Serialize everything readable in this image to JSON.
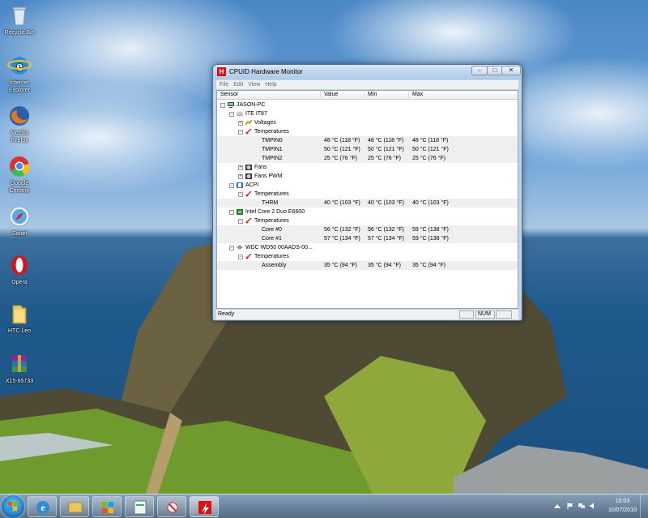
{
  "desktop": {
    "icons": [
      {
        "name": "recycle-bin-icon",
        "label": "Recycle Bin"
      },
      {
        "name": "internet-explorer-icon",
        "label": "Internet Explorer"
      },
      {
        "name": "mozilla-firefox-icon",
        "label": "Mozilla Firefox"
      },
      {
        "name": "google-chrome-icon",
        "label": "Google Chrome"
      },
      {
        "name": "safari-icon",
        "label": "Safari"
      },
      {
        "name": "opera-icon",
        "label": "Opera"
      },
      {
        "name": "folder-icon",
        "label": "HTC Leo"
      },
      {
        "name": "winrar-archive-icon",
        "label": "X15-65733"
      }
    ]
  },
  "window": {
    "title": "CPUID Hardware Monitor",
    "controls": {
      "minimize": "–",
      "maximize": "□",
      "close": "✕"
    },
    "menu": [
      "File",
      "Edit",
      "View",
      "Help"
    ],
    "columns": [
      "Sensor",
      "Value",
      "Min",
      "Max"
    ],
    "rows": [
      {
        "label": "JASON-PC",
        "value": "",
        "min": "",
        "max": ""
      },
      {
        "label": "ITE IT87",
        "value": "",
        "min": "",
        "max": ""
      },
      {
        "label": "Voltages",
        "value": "",
        "min": "",
        "max": ""
      },
      {
        "label": "Temperatures",
        "value": "",
        "min": "",
        "max": ""
      },
      {
        "label": "TMPIN0",
        "value": "48 °C  (118 °F)",
        "min": "48 °C  (118 °F)",
        "max": "48 °C  (118 °F)"
      },
      {
        "label": "TMPIN1",
        "value": "50 °C  (121 °F)",
        "min": "50 °C  (121 °F)",
        "max": "50 °C  (121 °F)"
      },
      {
        "label": "TMPIN2",
        "value": "25 °C  (76 °F)",
        "min": "25 °C  (76 °F)",
        "max": "25 °C  (76 °F)"
      },
      {
        "label": "Fans",
        "value": "",
        "min": "",
        "max": ""
      },
      {
        "label": "Fans PWM",
        "value": "",
        "min": "",
        "max": ""
      },
      {
        "label": "ACPI",
        "value": "",
        "min": "",
        "max": ""
      },
      {
        "label": "Temperatures",
        "value": "",
        "min": "",
        "max": ""
      },
      {
        "label": "THRM",
        "value": "40 °C  (103 °F)",
        "min": "40 °C  (103 °F)",
        "max": "40 °C  (103 °F)"
      },
      {
        "label": "Intel Core 2 Duo E6600",
        "value": "",
        "min": "",
        "max": ""
      },
      {
        "label": "Temperatures",
        "value": "",
        "min": "",
        "max": ""
      },
      {
        "label": "Core #0",
        "value": "56 °C  (132 °F)",
        "min": "56 °C  (132 °F)",
        "max": "59 °C  (138 °F)"
      },
      {
        "label": "Core #1",
        "value": "57 °C  (134 °F)",
        "min": "57 °C  (134 °F)",
        "max": "59 °C  (138 °F)"
      },
      {
        "label": "WDC WD50 00AADS-00...",
        "value": "",
        "min": "",
        "max": ""
      },
      {
        "label": "Temperatures",
        "value": "",
        "min": "",
        "max": ""
      },
      {
        "label": "Assembly",
        "value": "35 °C  (94 °F)",
        "min": "35 °C  (94 °F)",
        "max": "35 °C  (94 °F)"
      }
    ],
    "status": {
      "text": "Ready",
      "num": "NUM"
    }
  },
  "taskbar": {
    "clock_time": "15:03",
    "clock_date": "10/07/2010"
  }
}
